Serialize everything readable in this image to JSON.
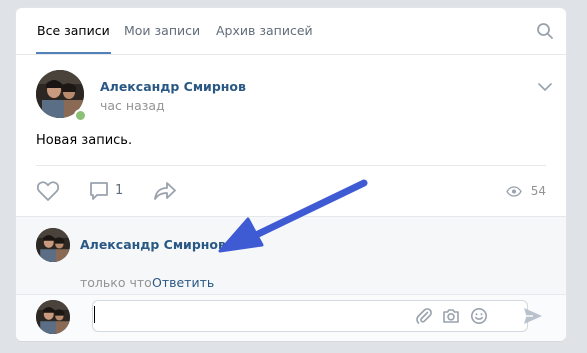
{
  "tabs": [
    {
      "label": "Все записи",
      "active": true
    },
    {
      "label": "Мои записи",
      "active": false
    },
    {
      "label": "Архив записей",
      "active": false
    }
  ],
  "post": {
    "author": "Александр Смирнов",
    "time": "час назад",
    "text": "Новая запись.",
    "comments_count": "1",
    "views_count": "54"
  },
  "comment": {
    "author": "Александр Смирнов",
    "time": "только что",
    "reply_label": "Ответить"
  },
  "composer": {
    "value": "",
    "placeholder": ""
  },
  "icons": {
    "search": "search-icon",
    "menu": "chevron-down-icon",
    "like": "heart-icon",
    "comment": "comment-icon",
    "share": "share-icon",
    "views": "eye-icon",
    "attach": "paperclip-icon",
    "camera": "camera-icon",
    "emoji": "smile-icon",
    "send": "send-icon"
  },
  "colors": {
    "link": "#2a5885",
    "accent": "#5181b8",
    "annotation_arrow": "#3f5bd4",
    "online": "#8ac176",
    "muted": "#939393"
  }
}
